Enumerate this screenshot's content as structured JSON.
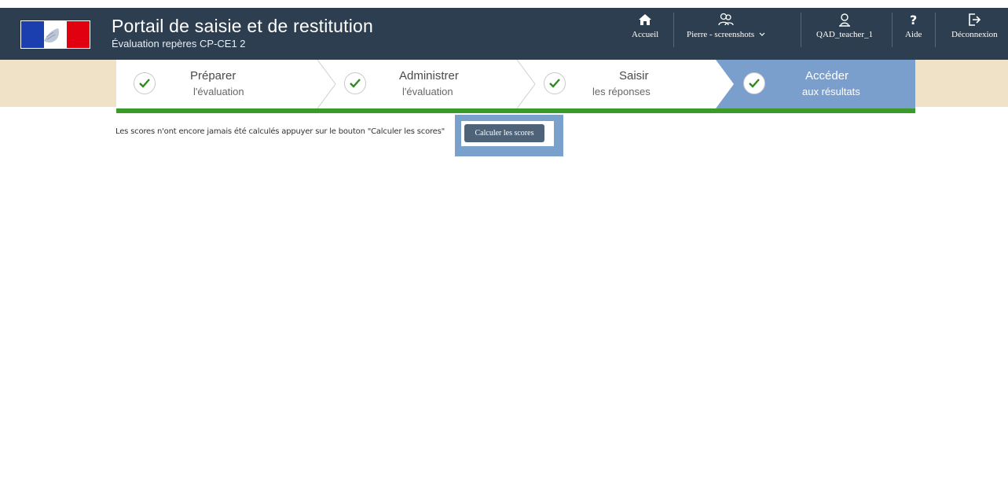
{
  "header": {
    "title": "Portail de saisie et de restitution",
    "subtitle": "Évaluation repères CP-CE1 2",
    "nav": {
      "home": "Accueil",
      "user_select": "Pierre - screenshots",
      "account": "QAD_teacher_1",
      "help": "Aide",
      "logout": "Déconnexion"
    }
  },
  "steps": [
    {
      "title": "Préparer",
      "subtitle": "l'évaluation",
      "done": true,
      "active": false
    },
    {
      "title": "Administrer",
      "subtitle": "l'évaluation",
      "done": true,
      "active": false
    },
    {
      "title": "Saisir",
      "subtitle": "les réponses",
      "done": true,
      "active": false
    },
    {
      "title": "Accéder",
      "subtitle": "aux résultats",
      "done": true,
      "active": true
    }
  ],
  "colors": {
    "header_bg": "#2d3e50",
    "band_bg": "#efe2c6",
    "active_step": "#7b9fcd",
    "progress": "#3a9a2a",
    "check": "#2f8a1e"
  },
  "content": {
    "message": "Les scores n'ont encore jamais été calculés appuyer sur le bouton \"Calculer les scores\"",
    "calculate_button": "Calculer les scores"
  }
}
